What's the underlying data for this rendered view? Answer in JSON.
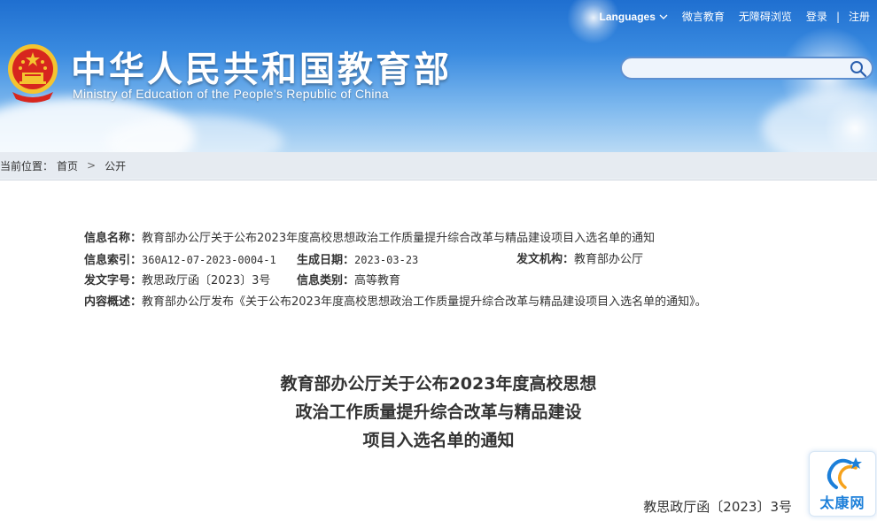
{
  "header": {
    "title": "中华人民共和国教育部",
    "subtitle": "Ministry of Education of the People's Republic of China"
  },
  "topnav": {
    "languages": "Languages",
    "weibo": "微言教育",
    "accessible": "无障碍浏览",
    "login": "登录",
    "register": "注册",
    "separator": "|"
  },
  "search": {
    "placeholder": ""
  },
  "breadcrumb": {
    "prefix": "当前位置：",
    "home": "首页",
    "arrow": ">",
    "current": "公开"
  },
  "meta": {
    "name_label": "信息名称：",
    "name_value": "教育部办公厅关于公布2023年度高校思想政治工作质量提升综合改革与精品建设项目入选名单的通知",
    "index_label": "信息索引：",
    "index_value": "360A12-07-2023-0004-1",
    "date_label": "生成日期：",
    "date_value": "2023-03-23",
    "org_label": "发文机构：",
    "org_value": "教育部办公厅",
    "docno_label": "发文字号：",
    "docno_value": "教思政厅函〔2023〕3号",
    "category_label": "信息类别：",
    "category_value": "高等教育",
    "summary_label": "内容概述：",
    "summary_value": "教育部办公厅发布《关于公布2023年度高校思想政治工作质量提升综合改革与精品建设项目入选名单的通知》。"
  },
  "document": {
    "title_line1": "教育部办公厅关于公布2023年度高校思想",
    "title_line2": "政治工作质量提升综合改革与精品建设",
    "title_line3": "项目入选名单的通知",
    "number": "教思政厅函〔2023〕3号"
  },
  "watermark": {
    "text": "太康网"
  },
  "colors": {
    "header_blue": "#1f6fd0",
    "watermark_blue": "#1c7fd9",
    "emblem_red": "#d7261e",
    "emblem_gold": "#f4c430"
  }
}
